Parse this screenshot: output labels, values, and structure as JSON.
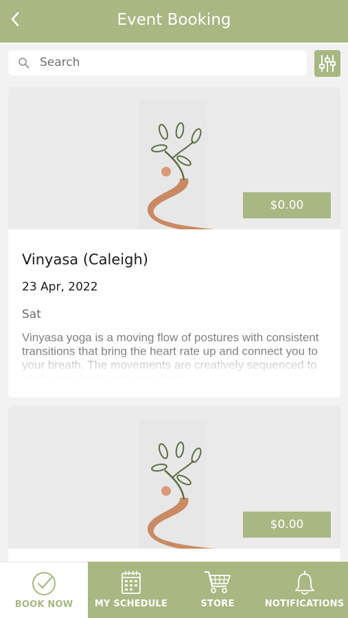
{
  "header": {
    "title": "Event Booking",
    "back_icon": "chevron-left-icon"
  },
  "search": {
    "placeholder": "Search",
    "icon": "search-icon"
  },
  "filter": {
    "icon": "sliders-icon"
  },
  "events": [
    {
      "name": "Vinyasa (Caleigh)",
      "date": "23 Apr, 2022",
      "day": "Sat",
      "price": "$0.00",
      "description": "Vinyasa yoga is a moving flow of postures with consistent transitions that bring the heart rate up and connect you to your breath. The movements are creatively sequenced to guide your body with ease from"
    },
    {
      "price": "$0.00"
    }
  ],
  "tabs": [
    {
      "label": "BOOK NOW",
      "icon": "check-circle-icon",
      "active": true
    },
    {
      "label": "MY SCHEDULE",
      "icon": "calendar-icon",
      "active": false
    },
    {
      "label": "STORE",
      "icon": "cart-icon",
      "active": false
    },
    {
      "label": "NOTIFICATIONS",
      "icon": "bell-icon",
      "active": false
    }
  ],
  "colors": {
    "accent": "#a9b782",
    "background": "#f2f2f2",
    "card": "#ffffff",
    "leaf": "#5e6a43",
    "path": "#c98a63"
  }
}
